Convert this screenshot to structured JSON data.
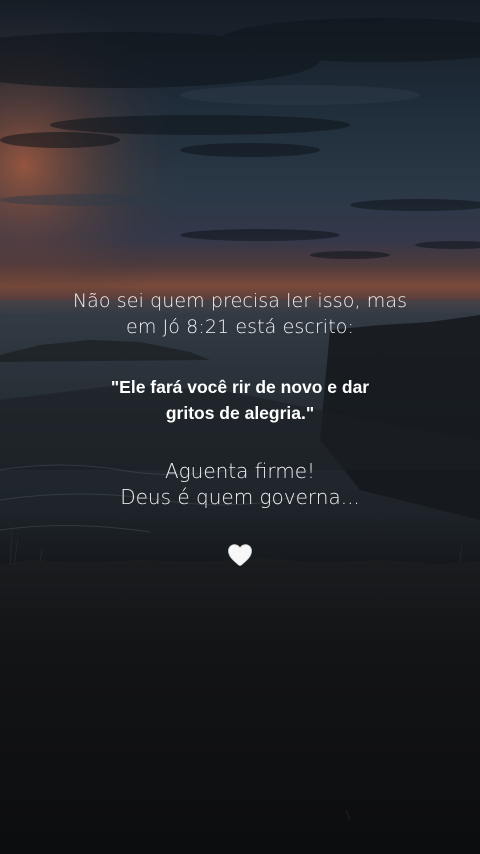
{
  "post": {
    "intro_line_1": "Não sei quem precisa ler isso, mas",
    "intro_line_2": "em Jó 8:21 está escrito:",
    "verse_line_1": "\"Ele fará você rir de novo e dar",
    "verse_line_2": "gritos de alegria.\"",
    "closing_line_1": "Aguenta firme!",
    "closing_line_2": "Deus é quem governa...",
    "heart_icon": "white-heart-icon"
  },
  "colors": {
    "text": "#ffffff",
    "sky_top": "#1b2733",
    "horizon_glow": "#b0573a",
    "ground": "#0f1012"
  }
}
